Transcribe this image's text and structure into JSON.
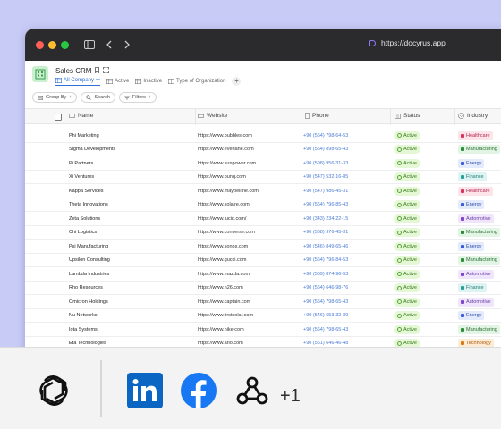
{
  "browser": {
    "url": "https://docyrus.app"
  },
  "app": {
    "title": "Sales CRM",
    "views": [
      {
        "label": "All Company",
        "active": true
      },
      {
        "label": "Active",
        "active": false
      },
      {
        "label": "Inactive",
        "active": false
      },
      {
        "label": "Type of Organization",
        "active": false
      }
    ]
  },
  "toolbar": {
    "group_by": "Group By",
    "search": "Search",
    "filters": "Filters"
  },
  "columns": {
    "name": "Name",
    "website": "Website",
    "phone": "Phone",
    "status": "Status",
    "industry": "Industry"
  },
  "rows": [
    {
      "name": "Phi Marketing",
      "website": "https://www.bubbles.com",
      "phone": "+90 (564) 798-64-53",
      "status": "Active",
      "industry": "Healthcare"
    },
    {
      "name": "Sigma Developments",
      "website": "https://www.everlane.com",
      "phone": "+90 (564) 898-65-43",
      "status": "Active",
      "industry": "Manufacturing"
    },
    {
      "name": "Pi Partners",
      "website": "https://www.sunpower.com",
      "phone": "+90 (598) 956-31-33",
      "status": "Active",
      "industry": "Energy"
    },
    {
      "name": "Xi Ventures",
      "website": "https://www.bunq.com",
      "phone": "+90 (547) 532-16-85",
      "status": "Active",
      "industry": "Finance"
    },
    {
      "name": "Kappa Services",
      "website": "https://www.maybelline.com",
      "phone": "+90 (547) 986-45-31",
      "status": "Active",
      "industry": "Healthcare"
    },
    {
      "name": "Theta Innovations",
      "website": "https://www.solaire.com",
      "phone": "+90 (564) 796-85-43",
      "status": "Active",
      "industry": "Energy"
    },
    {
      "name": "Zeta Solutions",
      "website": "https://www.lucid.com/",
      "phone": "+90 (343) 234-22-15",
      "status": "Active",
      "industry": "Automotive"
    },
    {
      "name": "Chi Logistics",
      "website": "https://www.converse.com",
      "phone": "+90 (568) 976-45-31",
      "status": "Active",
      "industry": "Manufacturing"
    },
    {
      "name": "Psi Manufacturing",
      "website": "https://www.sonos.com",
      "phone": "+90 (546) 849-65-46",
      "status": "Active",
      "industry": "Energy"
    },
    {
      "name": "Upsilon Consulting",
      "website": "https://www.gucci.com",
      "phone": "+90 (564) 796-84-53",
      "status": "Active",
      "industry": "Manufacturing"
    },
    {
      "name": "Lambda Industries",
      "website": "https://www.mazda.com",
      "phone": "+90 (569) 874-96-53",
      "status": "Active",
      "industry": "Automotive"
    },
    {
      "name": "Rho Resources",
      "website": "https://www.n26.com",
      "phone": "+90 (564) 646-98-76",
      "status": "Active",
      "industry": "Finance"
    },
    {
      "name": "Omicron Holdings",
      "website": "https://www.captain.com",
      "phone": "+90 (564) 798-65-43",
      "status": "Active",
      "industry": "Automotive"
    },
    {
      "name": "Nu Networks",
      "website": "https://www.firstsolar.com",
      "phone": "+90 (546) 653-32-89",
      "status": "Active",
      "industry": "Energy"
    },
    {
      "name": "Iota Systems",
      "website": "https://www.nike.com",
      "phone": "+90 (564) 798-65-43",
      "status": "Active",
      "industry": "Manufacturing"
    },
    {
      "name": "Eta Technologies",
      "website": "https://www.arlo.com",
      "phone": "+90 (561) 646-46-48",
      "status": "Active",
      "industry": "Technology"
    }
  ],
  "industry_colors": {
    "Healthcare": {
      "bg": "#fde4ea",
      "fg": "#b3264d",
      "sq": "#d9335c"
    },
    "Manufacturing": {
      "bg": "#e2f5e4",
      "fg": "#2b6e33",
      "sq": "#2f8a3c"
    },
    "Energy": {
      "bg": "#e4ebfd",
      "fg": "#2f4fa8",
      "sq": "#3b5bdb"
    },
    "Finance": {
      "bg": "#ddf4f3",
      "fg": "#227a76",
      "sq": "#2a9d97"
    },
    "Automotive": {
      "bg": "#f0e6fb",
      "fg": "#6a3cab",
      "sq": "#7e47c9"
    },
    "Technology": {
      "bg": "#fdebd3",
      "fg": "#a35a10",
      "sq": "#d67b17"
    }
  },
  "integrations": {
    "more_count": "+1"
  }
}
